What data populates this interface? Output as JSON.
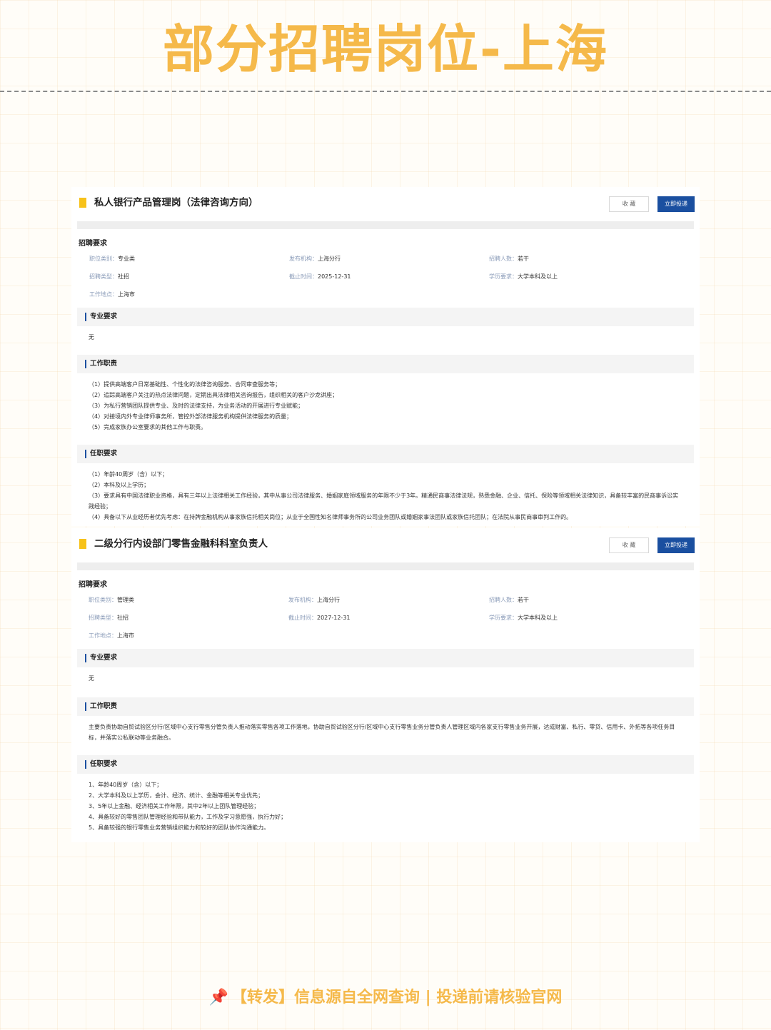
{
  "page_title": "部分招聘岗位-上海",
  "bottom_note": {
    "pin_icon": "📌",
    "text": "【转发】信息源自全网查询 | 投递前请核验官网"
  },
  "jobs": [
    {
      "title": "私人银行产品管理岗（法律咨询方向）",
      "fav_label": "收 藏",
      "apply_label": "立即投递",
      "req_title": "招聘要求",
      "info": {
        "category_label": "职位类别：",
        "category": "专业类",
        "org_label": "发布机构：",
        "org": "上海分行",
        "count_label": "招聘人数：",
        "count": "若干",
        "type_label": "招聘类型：",
        "type": "社招",
        "deadline_label": "截止时间：",
        "deadline": "2025-12-31",
        "edu_label": "学历要求：",
        "edu": "大学本科及以上",
        "location_label": "工作地点：",
        "location": "上海市"
      },
      "sections": [
        {
          "title": "专业要求",
          "lines": [
            "无"
          ]
        },
        {
          "title": "工作职责",
          "lines": [
            "（1）提供高端客户日常基础性、个性化的法律咨询服务、合同审查服务等；",
            "（2）追踪高端客户关注的热点法律问题，定期出具法律相关咨询报告，组织相关的客户沙龙讲座；",
            "（3）为私行营销团队提供专业、及时的法律支持，为业务活动的开展进行专业赋能；",
            "（4）对接境内外专业律师事务所，管控外部法律服务机构提供法律服务的质量；",
            "（5）完成家族办公室要求的其他工作与职责。"
          ]
        },
        {
          "title": "任职要求",
          "lines": [
            "（1）年龄40周岁（含）以下；",
            "（2）本科及以上学历；",
            "（3）要求具有中国法律职业资格，具有三年以上法律相关工作经验，其中从事公司法律服务、婚姻家庭领域服务的年限不少于3年。精通民商事法律法规，熟悉金融、企业、信托、保险等领域相关法律知识，具备较丰富的民商事诉讼实践经验；",
            "（4）具备以下从业经历者优先考虑：在持牌金融机构从事家族信托相关岗位；从业于全国性知名律师事务所的公司业务团队或婚姻家事法团队或家族信托团队；在法院从事民商事审判工作的。"
          ]
        }
      ]
    },
    {
      "title": "二级分行内设部门零售金融科科室负责人",
      "fav_label": "收 藏",
      "apply_label": "立即投递",
      "req_title": "招聘要求",
      "info": {
        "category_label": "职位类别：",
        "category": "管理类",
        "org_label": "发布机构：",
        "org": "上海分行",
        "count_label": "招聘人数：",
        "count": "若干",
        "type_label": "招聘类型：",
        "type": "社招",
        "deadline_label": "截止时间：",
        "deadline": "2027-12-31",
        "edu_label": "学历要求：",
        "edu": "大学本科及以上",
        "location_label": "工作地点：",
        "location": "上海市"
      },
      "sections": [
        {
          "title": "专业要求",
          "lines": [
            "无"
          ]
        },
        {
          "title": "工作职责",
          "lines": [
            "主要负责协助自贸试验区分行/区域中心支行零售分管负责人推动落实零售各项工作落地，协助自贸试验区分行/区域中心支行零售业务分管负责人管理区域内各家支行零售业务开展，达成财富、私行、零贷、信用卡、外拓等各项任务目标，并落实公私联动等业务融合。"
          ]
        },
        {
          "title": "任职要求",
          "lines": [
            "1、年龄40周岁（含）以下；",
            "2、大学本科及以上学历，会计、经济、统计、金融等相关专业优先；",
            "3、5年以上金融、经济相关工作年限，其中2年以上团队管理经验；",
            "4、具备较好的零售团队管理经验和带队能力，工作及学习意愿强，执行力好；",
            "5、具备较强的银行零售业务营销组织能力和较好的团队协作沟通能力。"
          ]
        }
      ]
    }
  ]
}
